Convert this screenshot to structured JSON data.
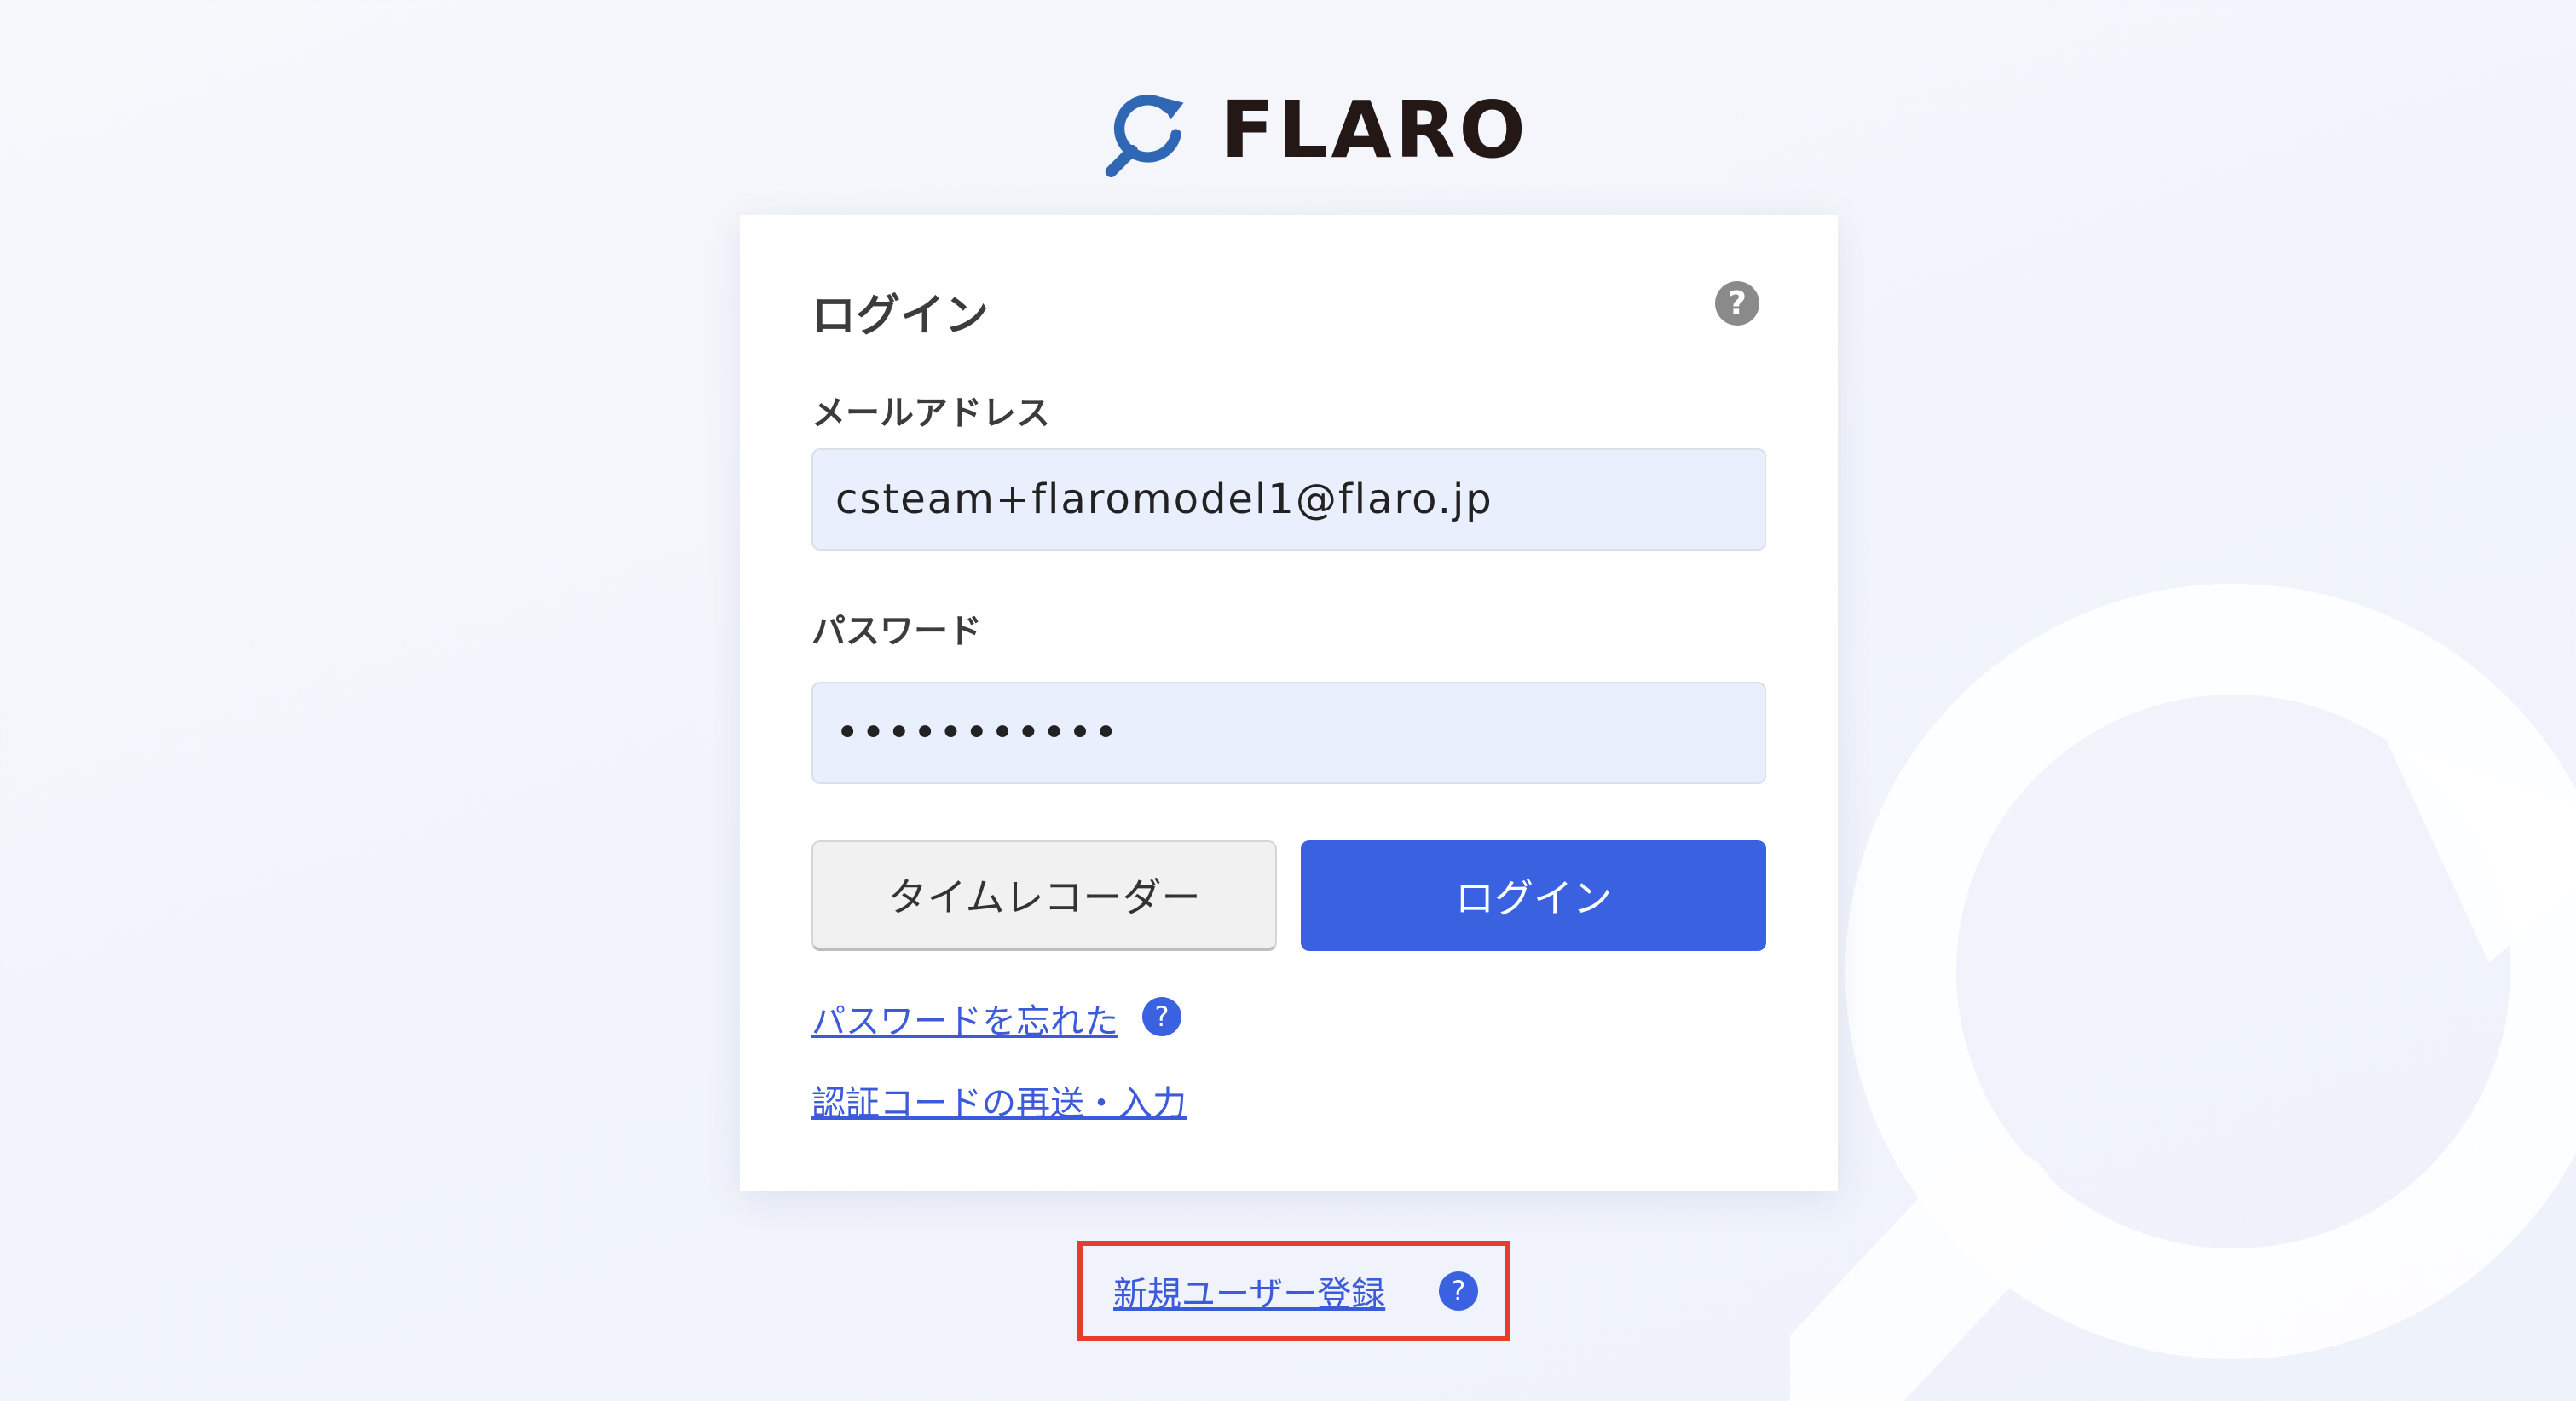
{
  "brand": {
    "name": "FLARO",
    "logo_icon": "magnifier-refresh-icon",
    "accent_color": "#2f67b5"
  },
  "login_card": {
    "title": "ログイン",
    "help_icon": "question-circle-icon",
    "help_symbol": "?",
    "email": {
      "label": "メールアドレス",
      "value": "csteam+flaromodel1@flaro.jp"
    },
    "password": {
      "label": "パスワード",
      "value": "•••••••••••"
    },
    "buttons": {
      "time_recorder": "タイムレコーダー",
      "login": "ログイン"
    },
    "links": {
      "forgot_password": "パスワードを忘れた",
      "resend_code": "認証コードの再送・入力"
    }
  },
  "register": {
    "label": "新規ユーザー登録",
    "help_symbol": "?"
  },
  "colors": {
    "primary_button": "#3a62e0",
    "link": "#3b5bd9",
    "highlight": "#e53e2f"
  }
}
